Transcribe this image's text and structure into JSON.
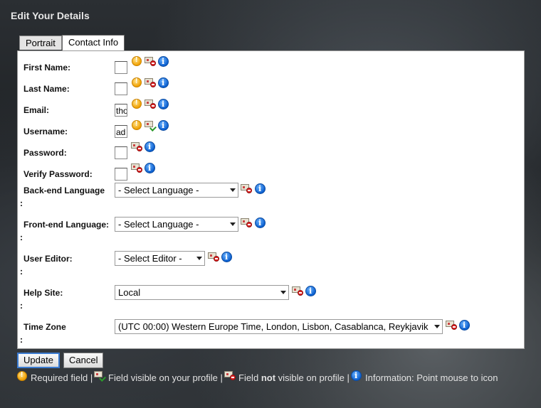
{
  "dialog": {
    "title": "Edit Your Details"
  },
  "tabs": [
    {
      "label": "Portrait",
      "active": false
    },
    {
      "label": "Contact Info",
      "active": true
    }
  ],
  "fields": {
    "first_name": {
      "label": "First Name:",
      "value": ""
    },
    "last_name": {
      "label": "Last Name:",
      "value": ""
    },
    "email": {
      "label": "Email:",
      "value": "tho"
    },
    "username": {
      "label": "Username:",
      "value": "ad"
    },
    "password": {
      "label": "Password:",
      "value": ""
    },
    "verify_password": {
      "label": "Verify Password:",
      "value": ""
    },
    "backend_language": {
      "label": "Back-end Language",
      "colon": ":",
      "selected": "- Select Language -"
    },
    "frontend_language": {
      "label": "Front-end Language:",
      "colon": ":",
      "selected": "- Select Language -"
    },
    "user_editor": {
      "label": "User Editor:",
      "colon": ":",
      "selected": "- Select Editor -"
    },
    "help_site": {
      "label": "Help Site:",
      "colon": ":",
      "selected": "Local"
    },
    "time_zone": {
      "label": "Time Zone",
      "colon": ":",
      "selected": "(UTC 00:00) Western Europe Time, London, Lisbon, Casablanca, Reykjavik"
    }
  },
  "buttons": {
    "update": "Update",
    "cancel": "Cancel"
  },
  "legend": {
    "required": "Required field |",
    "visible": "Field visible on your profile |",
    "not_visible_pre": "Field",
    "not_visible_bold": "not",
    "not_visible_post": "visible on profile |",
    "information": "Information: Point mouse to icon"
  },
  "icons": [
    "required-icon",
    "visible-on-profile-icon",
    "not-visible-on-profile-icon",
    "information-icon"
  ],
  "colors": {
    "required": "#f0a000",
    "not_visible": "#d22222",
    "visible": "#2c9a2c",
    "info": "#0b5fcf"
  }
}
